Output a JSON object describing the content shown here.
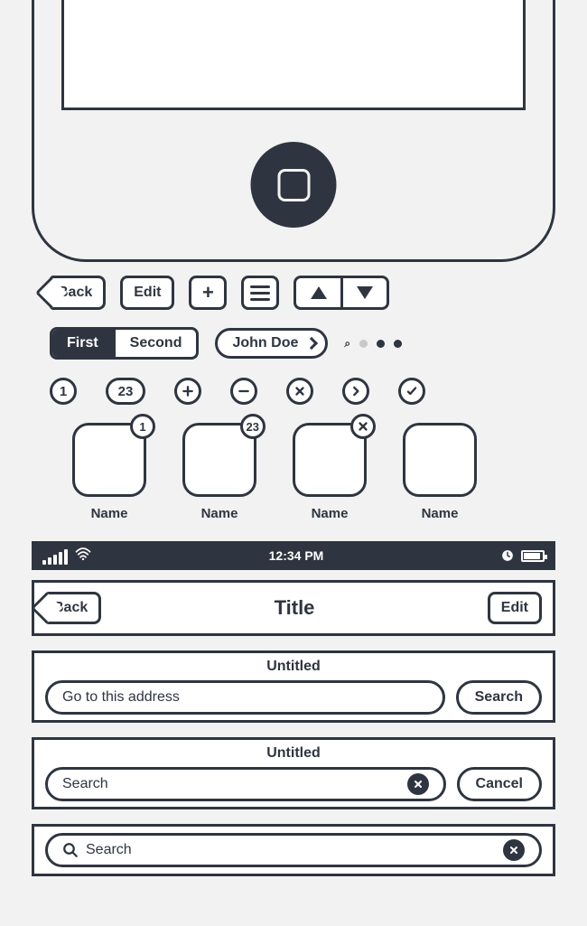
{
  "toolbar": {
    "back_label": "Back",
    "edit_label": "Edit",
    "plus_tooltip": "+",
    "menu_tooltip": "Menu"
  },
  "segmented": {
    "first_label": "First",
    "second_label": "Second"
  },
  "chip": {
    "label": "John Doe"
  },
  "circle_icons": {
    "one": "1",
    "twentythree": "23"
  },
  "apps": [
    {
      "label": "Name",
      "badge": "1"
    },
    {
      "label": "Name",
      "badge": "23"
    },
    {
      "label": "Name",
      "badge_icon": "close"
    },
    {
      "label": "Name"
    }
  ],
  "status_bar": {
    "time": "12:34 PM"
  },
  "nav_bar": {
    "back_label": "Back",
    "title": "Title",
    "edit_label": "Edit"
  },
  "address_panel": {
    "title": "Untitled",
    "placeholder": "Go to this address",
    "search_label": "Search"
  },
  "search_panel": {
    "title": "Untitled",
    "placeholder": "Search",
    "cancel_label": "Cancel"
  },
  "search_bar_simple": {
    "placeholder": "Search"
  }
}
